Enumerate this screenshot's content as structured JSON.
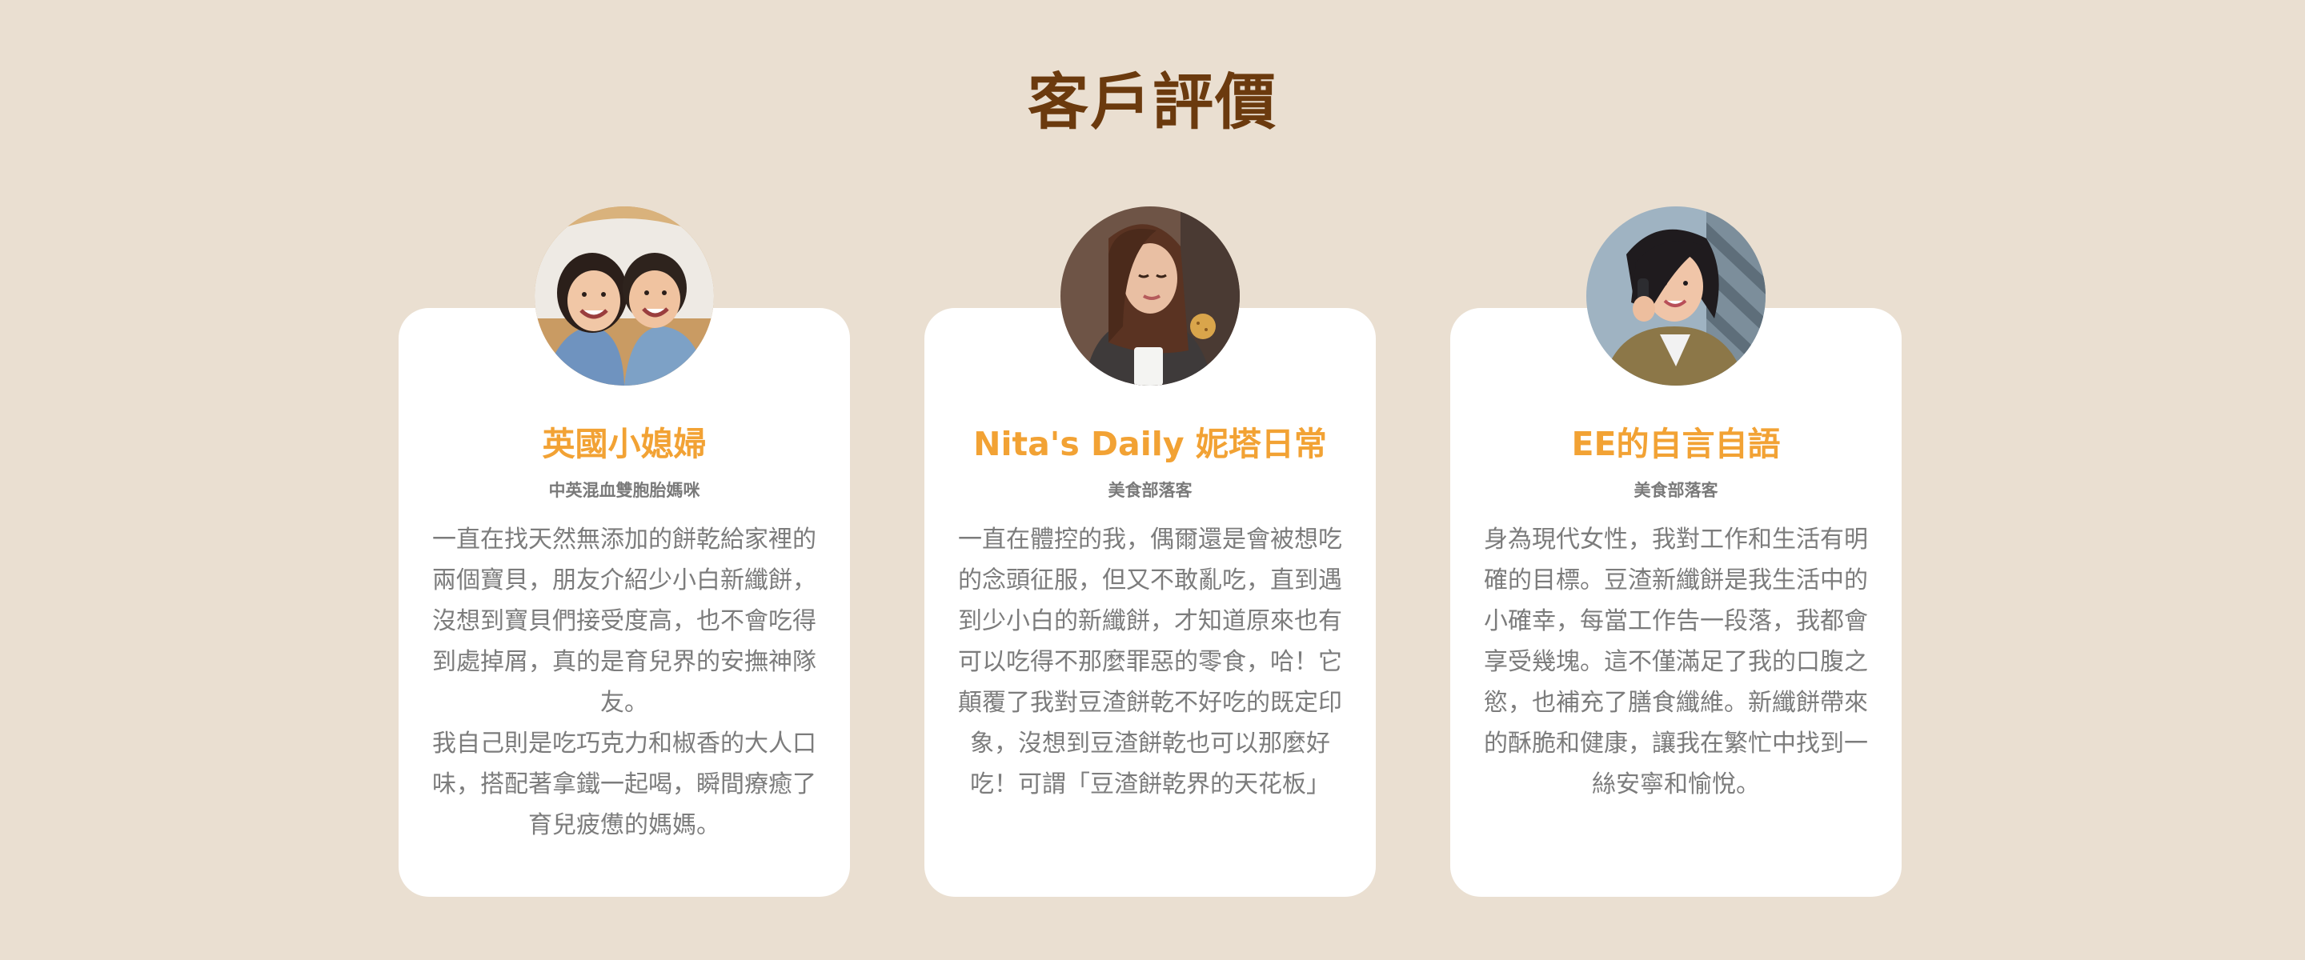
{
  "section": {
    "title": "客戶評價"
  },
  "testimonials": [
    {
      "name": "英國小媳婦",
      "role": "中英混血雙胞胎媽咪",
      "paragraphs": [
        "一直在找天然無添加的餅乾給家裡的兩個寶貝，朋友介紹少小白新纖餅，沒想到寶貝們接受度高，也不會吃得到處掉屑，真的是育兒界的安撫神隊友。",
        "我自己則是吃巧克力和椒香的大人口味，搭配著拿鐵一起喝，瞬間療癒了育兒疲憊的媽媽。"
      ],
      "avatar_icon": "photo-two-children-icon"
    },
    {
      "name": "Nita's Daily 妮塔日常",
      "role": "美食部落客",
      "paragraphs": [
        "一直在體控的我，偶爾還是會被想吃的念頭征服，但又不敢亂吃，直到遇到少小白的新纖餅，才知道原來也有可以吃得不那麼罪惡的零食，哈！它顛覆了我對豆渣餅乾不好吃的既定印象，沒想到豆渣餅乾也可以那麼好吃！可謂「豆渣餅乾界的天花板」"
      ],
      "avatar_icon": "photo-woman-with-cookie-icon"
    },
    {
      "name": "EE的自言自語",
      "role": "美食部落客",
      "paragraphs": [
        "身為現代女性，我對工作和生活有明確的目標。豆渣新纖餅是我生活中的小確幸，每當工作告一段落，我都會享受幾塊。這不僅滿足了我的口腹之慾，也補充了膳食纖維。新纖餅帶來的酥脆和健康，讓我在繁忙中找到一絲安寧和愉悅。"
      ],
      "avatar_icon": "photo-woman-on-phone-icon"
    }
  ],
  "colors": {
    "background": "#EADFD1",
    "title": "#6B3A0E",
    "accent": "#F2A234",
    "card": "#FFFFFF",
    "text": "#7C7C7C"
  }
}
